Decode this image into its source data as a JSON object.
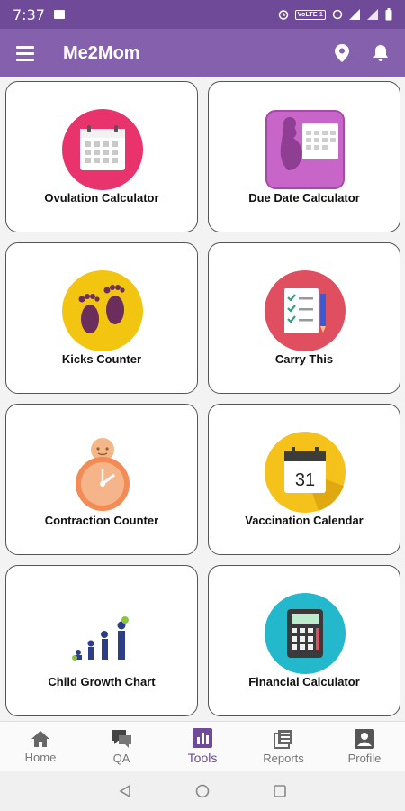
{
  "status_bar": {
    "time": "7:37",
    "volte": "VoLTE 1"
  },
  "app_bar": {
    "title": "Me2Mom"
  },
  "tools": [
    {
      "label": "Ovulation Calculator",
      "icon": "calendar-icon"
    },
    {
      "label": "Due Date Calculator",
      "icon": "pregnancy-calendar-icon"
    },
    {
      "label": "Kicks Counter",
      "icon": "footprints-icon"
    },
    {
      "label": "Carry This",
      "icon": "checklist-icon"
    },
    {
      "label": "Contraction Counter",
      "icon": "clock-baby-icon"
    },
    {
      "label": "Vaccination Calendar",
      "icon": "calendar-31-icon"
    },
    {
      "label": "Child Growth Chart",
      "icon": "growth-figures-icon"
    },
    {
      "label": "Financial Calculator",
      "icon": "calculator-icon"
    }
  ],
  "calendar_day": "31",
  "bottom_nav": [
    {
      "label": "Home",
      "icon": "home-icon"
    },
    {
      "label": "QA",
      "icon": "chat-icon"
    },
    {
      "label": "Tools",
      "icon": "bar-chart-icon",
      "active": true
    },
    {
      "label": "Reports",
      "icon": "reports-icon"
    },
    {
      "label": "Profile",
      "icon": "profile-icon"
    }
  ],
  "colors": {
    "primary": "#8560ad",
    "primary_dark": "#6f4a99"
  }
}
